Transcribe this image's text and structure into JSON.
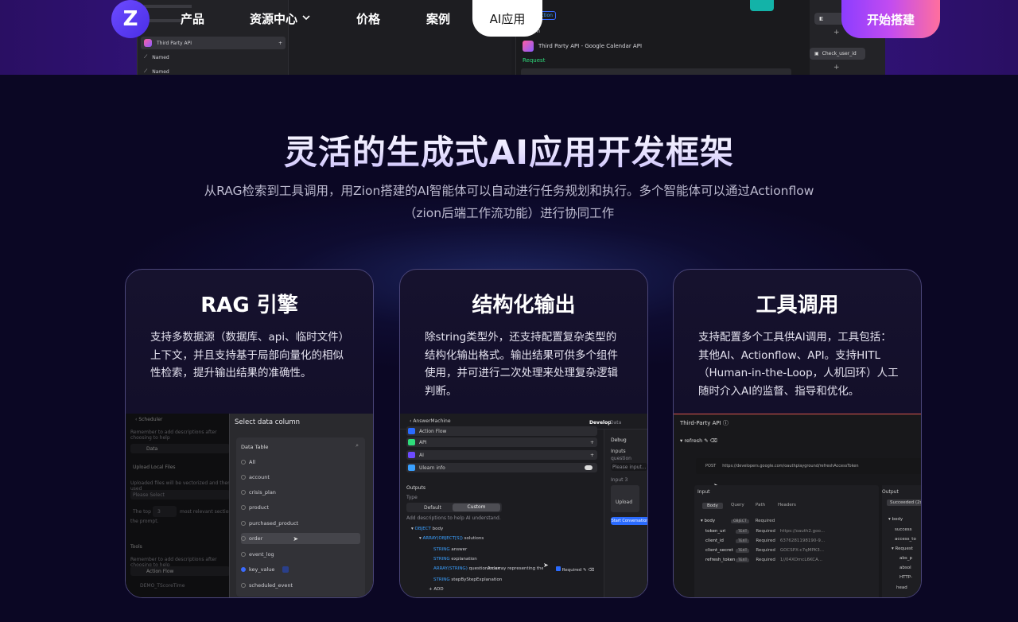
{
  "nav": {
    "logo_glyph": "Z",
    "items": [
      {
        "label": "产品",
        "has_dropdown": false
      },
      {
        "label": "资源中心",
        "has_dropdown": true
      },
      {
        "label": "价格",
        "has_dropdown": false
      },
      {
        "label": "案例",
        "has_dropdown": false
      }
    ],
    "active_item": "AI应用",
    "cta_label": "开始搭建",
    "dropdown_icon": "chevron-down-icon",
    "colors": {
      "logo": "#5b3df0",
      "cta_start": "#8c3dff",
      "cta_end": "#ff6f9e"
    }
  },
  "hero_preview": {
    "sidebar_items": [
      "Third Party API",
      "Named",
      "Named"
    ],
    "connection_tag": "Connection",
    "section_label": "Action",
    "api_name": "Third Party API - Google Calendar API",
    "request_label": "Request",
    "node_label": "Check_user_id"
  },
  "section": {
    "heading": "灵活的生成式AI应用开发框架",
    "subline_1": "从RAG检索到工具调用，用Zion搭建的AI智能体可以自动进行任务规划和执行。多个智能体可以通过Actionflow",
    "subline_2": "（zion后端工作流功能）进行协同工作"
  },
  "cards": [
    {
      "title": "RAG 引擎",
      "description": "支持多数据源（数据库、api、临时文件）上下文，并且支持基于局部向量化的相似性检索，提升输出结果的准确性。",
      "preview": {
        "breadcrumb": "Scheduler",
        "hint": "Remember to add descriptions after choosing to help",
        "data_label": "Data",
        "upload_label": "Upload Local Files",
        "upload_hint": "Uploaded files will be vectorized and then used",
        "placeholder": "Please Select",
        "top_label": "The top",
        "top_value": "3",
        "top_suffix": "most relevant section",
        "prompt_label": "the prompt.",
        "tools_label": "Tools",
        "tools_hint": "Remember to add descriptions after choosing to help",
        "tool_item": "Action Flow",
        "tool_item_2": "DEMO_TScoreTime",
        "panel_title": "Select data column",
        "table_label": "Data Table",
        "options": [
          "All",
          "account",
          "crisis_plan",
          "product",
          "purchased_product",
          "order",
          "event_log",
          "key_value",
          "scheduled_event"
        ],
        "highlighted": "order",
        "selected": "key_value"
      }
    },
    {
      "title": "结构化输出",
      "description": "除string类型外，还支持配置复杂类型的结构化输出格式。输出结果可供多个组件使用，并可进行二次处理来处理复杂逻辑判断。",
      "preview": {
        "app_name": "AnswerMachine",
        "tab_develop": "Develop",
        "tab_data": "Data",
        "rows": [
          "Action Flow",
          "API",
          "AI",
          "Ulearn info"
        ],
        "outputs_label": "Outputs",
        "type_label": "Type",
        "seg_default": "Default",
        "seg_custom": "Custom",
        "desc_hint": "Add descriptions to help AI understand.",
        "debug_label": "Debug",
        "inputs_label": "Inputs",
        "question_label": "question",
        "input_placeholder": "Please input...",
        "input_label": "Input 3",
        "upload_label": "Upload",
        "start_button": "Start Conversation",
        "tree": {
          "root_type": "OBJECT",
          "root_key": "body",
          "array_type": "ARRAY(OBJECT[S])",
          "array_key": "solutions",
          "string_type": "STRING",
          "f1": "answer",
          "f2": "explanation",
          "array_str_type": "ARRAY(STRING)",
          "f3": "questionIndex",
          "f3_desc": "An array representing the index of two questions, e.g. [\"question1\",\"a\",\"part1\"]",
          "required": "Required",
          "f4": "stepByStepExplanation",
          "add_label": "+ ADD"
        }
      }
    },
    {
      "title": "工具调用",
      "description": "支持配置多个工具供AI调用，工具包括：其他AI、Actionflow、API。支持HITL（Human-in-the-Loop，人机回环）人工随时介入AI的监督、指导和优化。",
      "preview": {
        "title": "Third-Party API",
        "endpoint": "refresh",
        "method": "POST",
        "url": "https://developers.google.com/oauthplayground/refreshAccessToken",
        "input_label": "Input",
        "output_label": "Output",
        "tabs": [
          "Body",
          "Query",
          "Path",
          "Headers"
        ],
        "body_type": "OBJECT",
        "required": "Required",
        "params": [
          {
            "name": "token_uri",
            "type": "TEXT",
            "value": "https://oauth2.goo..."
          },
          {
            "name": "client_id",
            "type": "TEXT",
            "value": "6376281198190-9..."
          },
          {
            "name": "client_secret",
            "type": "TEXT",
            "value": "GOCSPX-c7qMPK3..."
          },
          {
            "name": "refresh_token",
            "type": "TEXT",
            "value": "1//04XDmcL6KCA..."
          }
        ],
        "status": "Succeeded (2xx)",
        "output_items": [
          "body",
          "success",
          "access_to",
          "Request",
          "abs_p",
          "absol",
          "HTTP-",
          "head"
        ]
      }
    }
  ]
}
